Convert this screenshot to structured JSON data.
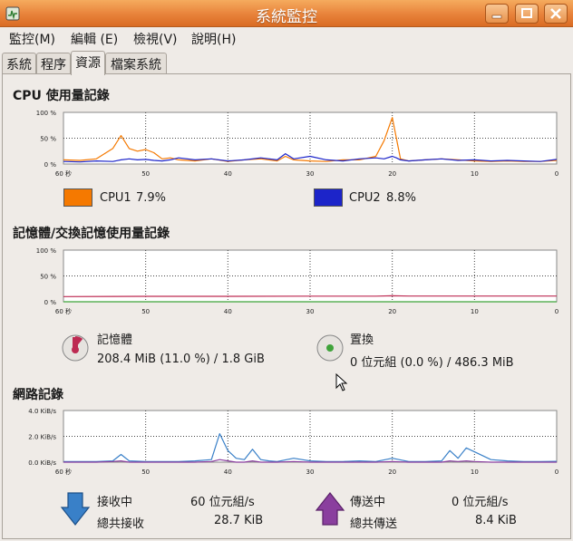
{
  "window": {
    "title": "系統監控"
  },
  "menu": [
    "監控(M)",
    "編輯 (E)",
    "檢視(V)",
    "說明(H)"
  ],
  "tabs": [
    "系統",
    "程序",
    "資源",
    "檔案系統"
  ],
  "active_tab": "資源",
  "cpu": {
    "title": "CPU 使用量記錄",
    "y_ticks": [
      "100 %",
      "50 %",
      "0 %"
    ],
    "x_ticks": [
      "60 秒",
      "50",
      "40",
      "30",
      "20",
      "10",
      "0"
    ],
    "series": [
      {
        "name": "CPU1",
        "value_text": "7.9%",
        "color": "#f57900"
      },
      {
        "name": "CPU2",
        "value_text": "8.8%",
        "color": "#1c24c9"
      }
    ]
  },
  "memory": {
    "title": "記憶體/交換記憶使用量記錄",
    "y_ticks": [
      "100 %",
      "50 %",
      "0 %"
    ],
    "x_ticks": [
      "60 秒",
      "50",
      "40",
      "30",
      "20",
      "10",
      "0"
    ],
    "mem_label": "記憶體",
    "mem_value": "208.4 MiB (11.0 %) / 1.8 GiB",
    "mem_color": "#bd2a52",
    "swap_label": "置換",
    "swap_value": "0 位元組 (0.0 %) / 486.3 MiB",
    "swap_color": "#3fa33a"
  },
  "network": {
    "title": "網路記錄",
    "y_ticks": [
      "4.0 KiB/s",
      "2.0 KiB/s",
      "0.0 KiB/s"
    ],
    "x_ticks": [
      "60 秒",
      "50",
      "40",
      "30",
      "20",
      "10",
      "0"
    ],
    "recv_label": "接收中",
    "recv_rate": "60 位元組/s",
    "recv_total_label": "總共接收",
    "recv_total": "28.7 KiB",
    "send_label": "傳送中",
    "send_rate": "0 位元組/s",
    "send_total_label": "總共傳送",
    "send_total": "8.4 KiB",
    "recv_color": "#3980c8",
    "send_color": "#8a3f9e"
  },
  "chart_data": [
    {
      "type": "line",
      "x": [
        60,
        58,
        56,
        54,
        53,
        52,
        51,
        50,
        49,
        48,
        47,
        46,
        44,
        42,
        40,
        38,
        36,
        34,
        33,
        32,
        30,
        28,
        26,
        24,
        22,
        21,
        20,
        19.5,
        19,
        18,
        16,
        14,
        12,
        10,
        8,
        6,
        4,
        2,
        0
      ],
      "series": [
        {
          "name": "CPU1",
          "values": [
            8,
            7,
            10,
            30,
            55,
            30,
            25,
            28,
            22,
            10,
            12,
            8,
            6,
            10,
            5,
            8,
            10,
            6,
            15,
            8,
            6,
            5,
            8,
            8,
            15,
            45,
            90,
            50,
            10,
            6,
            8,
            10,
            8,
            6,
            5,
            6,
            5,
            5,
            7
          ]
        },
        {
          "name": "CPU2",
          "values": [
            5,
            4,
            6,
            5,
            8,
            10,
            8,
            9,
            7,
            6,
            8,
            12,
            8,
            10,
            6,
            8,
            12,
            8,
            20,
            10,
            15,
            8,
            6,
            10,
            12,
            10,
            15,
            12,
            8,
            6,
            8,
            10,
            7,
            8,
            6,
            7,
            6,
            5,
            9
          ]
        }
      ],
      "ylim": [
        0,
        100
      ],
      "xlim": [
        60,
        0
      ]
    },
    {
      "type": "line",
      "x": [
        60,
        50,
        40,
        30,
        22,
        20,
        18,
        10,
        0
      ],
      "series": [
        {
          "name": "記憶體",
          "values": [
            10,
            10.5,
            10.5,
            10.8,
            10.8,
            11.5,
            11,
            11,
            11
          ]
        },
        {
          "name": "置換",
          "values": [
            0,
            0,
            0,
            0,
            0,
            0,
            0,
            0,
            0
          ]
        }
      ],
      "ylim": [
        0,
        100
      ],
      "xlim": [
        60,
        0
      ]
    },
    {
      "type": "line",
      "x": [
        60,
        56,
        54,
        53,
        52,
        50,
        46,
        44,
        42,
        41,
        40,
        39,
        38,
        37,
        36,
        35,
        34,
        32,
        30,
        28,
        26,
        24,
        22,
        20,
        18,
        16,
        14,
        13,
        12,
        11,
        10,
        8,
        6,
        4,
        2,
        0
      ],
      "series": [
        {
          "name": "接收中",
          "values": [
            0.05,
            0.05,
            0.1,
            0.6,
            0.1,
            0.05,
            0.05,
            0.1,
            0.2,
            2.2,
            0.9,
            0.3,
            0.2,
            1.0,
            0.2,
            0.1,
            0.05,
            0.3,
            0.1,
            0.05,
            0.05,
            0.1,
            0.05,
            0.3,
            0.05,
            0.05,
            0.1,
            0.9,
            0.3,
            1.1,
            0.8,
            0.2,
            0.1,
            0.05,
            0.05,
            0.06
          ]
        },
        {
          "name": "傳送中",
          "values": [
            0,
            0,
            0.05,
            0.1,
            0,
            0,
            0,
            0,
            0.05,
            0.2,
            0.1,
            0,
            0,
            0.1,
            0,
            0,
            0,
            0.05,
            0,
            0,
            0,
            0,
            0,
            0.05,
            0,
            0,
            0,
            0.1,
            0.05,
            0.1,
            0.05,
            0,
            0,
            0,
            0,
            0
          ]
        }
      ],
      "ylim": [
        0,
        4.0
      ],
      "xlim": [
        60,
        0
      ]
    }
  ]
}
